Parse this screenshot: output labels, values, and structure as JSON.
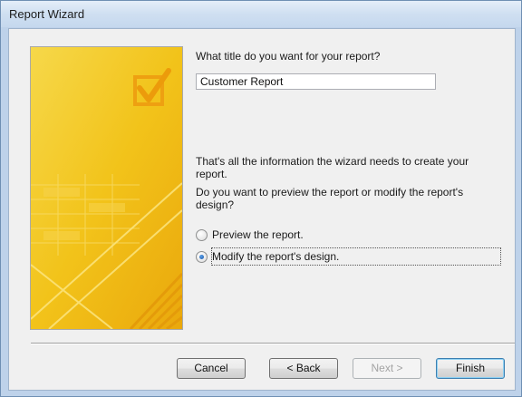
{
  "window": {
    "title": "Report Wizard"
  },
  "prompt": {
    "title_question": "What title do you want for your report?"
  },
  "title_field": {
    "value": "Customer Report"
  },
  "info": {
    "line1": "That's all the information the wizard needs to create your",
    "line2": "report.",
    "question_line1": "Do you want to preview the report or modify the report's",
    "question_line2": "design?"
  },
  "options": [
    {
      "label": "Preview the report.",
      "selected": false
    },
    {
      "label": "Modify the report's design.",
      "selected": true
    }
  ],
  "buttons": {
    "cancel": "Cancel",
    "back": "< Back",
    "next": "Next >",
    "finish": "Finish"
  },
  "colors": {
    "art_yellow": "#f5c518",
    "art_orange": "#e8a00a",
    "accent_blue": "#1b56a8"
  },
  "icons": {
    "art": "checkmark-checkbox-icon"
  }
}
